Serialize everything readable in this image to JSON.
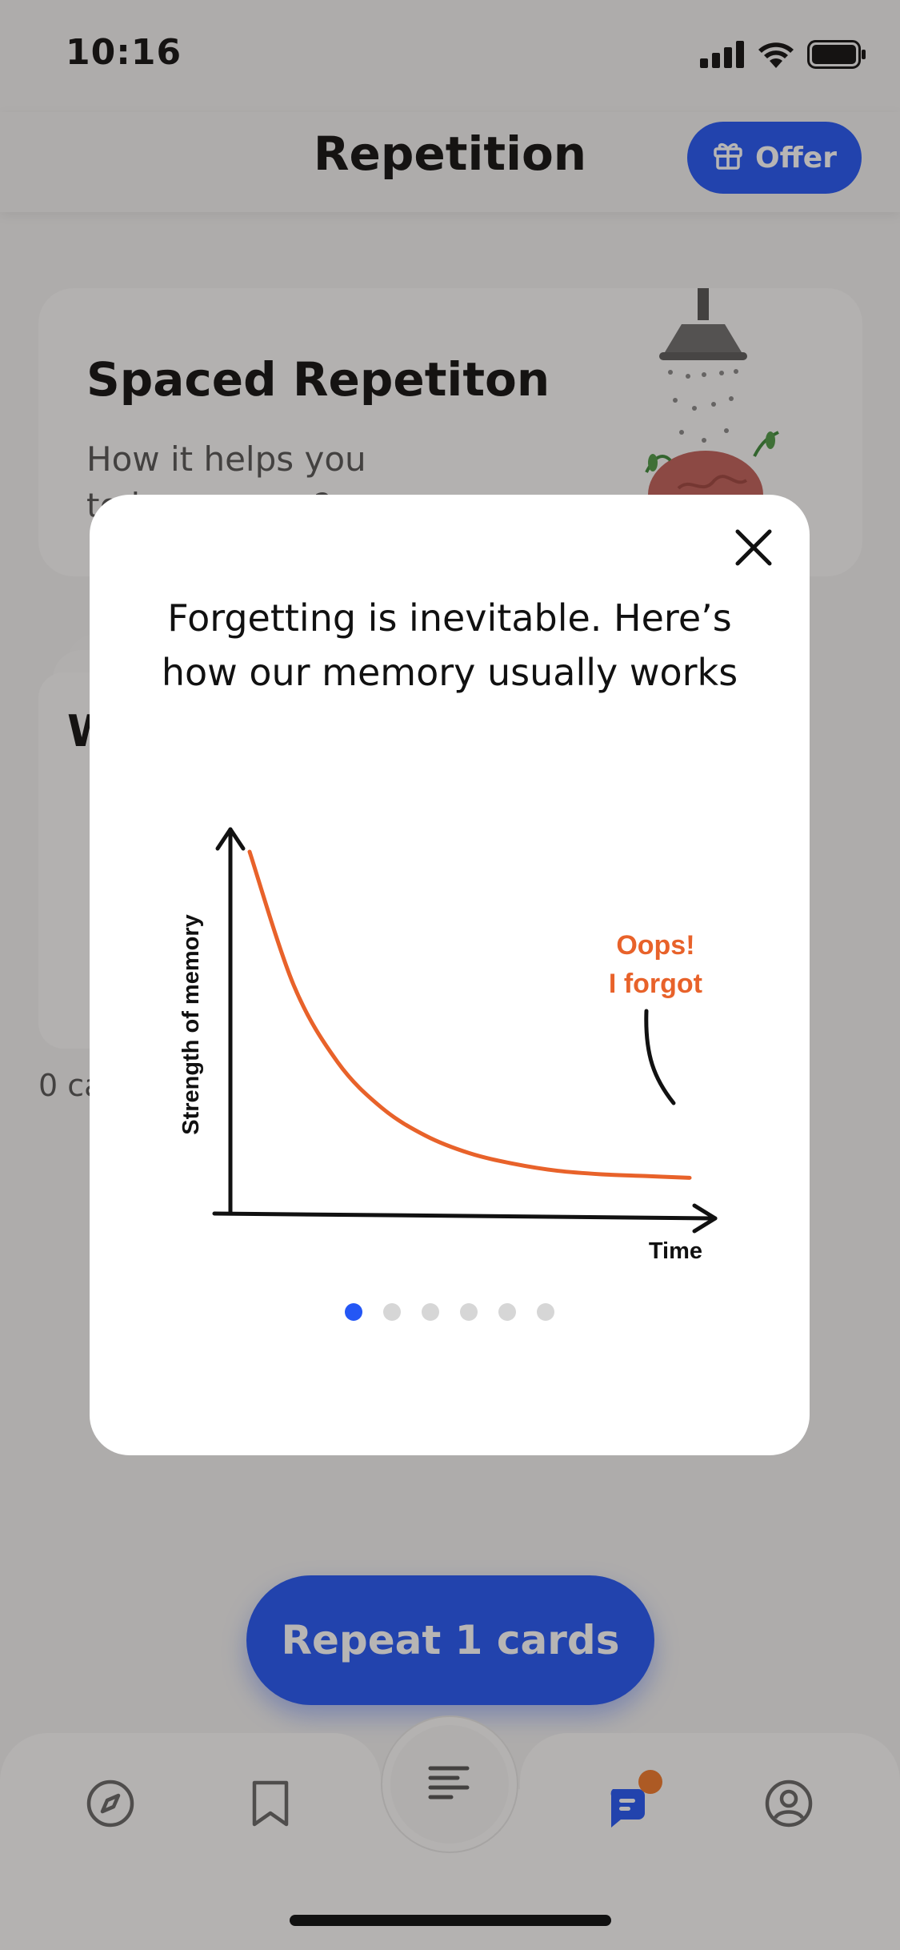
{
  "status_bar": {
    "time": "10:16"
  },
  "header": {
    "title": "Repetition",
    "offer_label": "Offer"
  },
  "promo_card": {
    "title": "Spaced Repetiton",
    "subtitle": "How it helps you to learn more?"
  },
  "deck": {
    "title_letter": "W",
    "count_text": "0 cards"
  },
  "repeat_button": {
    "label": "Repeat 1 cards"
  },
  "tab_bar": {
    "items": [
      "explore-icon",
      "bookmark-icon",
      "list-icon",
      "repetition-icon",
      "profile-icon"
    ],
    "active_index": 3,
    "badge_color": "#f07a2c"
  },
  "modal": {
    "title": "Forgetting is inevitable. Here’s how our memory  usually works",
    "pager": {
      "total": 6,
      "active": 0
    }
  },
  "chart_data": {
    "type": "line",
    "title": "",
    "xlabel": "Time",
    "ylabel": "Strength of memory",
    "annotation": "Oops!\nI forgot",
    "curve": "exponential decay",
    "series": [
      {
        "x": [
          0,
          1,
          2,
          3,
          4,
          5,
          6,
          7,
          8,
          9,
          10
        ],
        "values": [
          100,
          62,
          40,
          27,
          19,
          14,
          11,
          9,
          8,
          7.5,
          7
        ]
      }
    ],
    "xlim": [
      0,
      10
    ],
    "ylim": [
      0,
      100
    ],
    "grid": false,
    "curve_color": "#e8622a"
  },
  "colors": {
    "accent": "#2457f5",
    "orange": "#e8622a",
    "background": "#f2f2f2"
  }
}
